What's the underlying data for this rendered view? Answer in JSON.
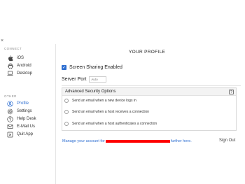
{
  "window": {
    "close_glyph": "×"
  },
  "sidebar": {
    "connect_label": "CONNECT",
    "connect_items": [
      {
        "label": "iOS",
        "icon": "apple-icon"
      },
      {
        "label": "Android",
        "icon": "android-icon"
      },
      {
        "label": "Desktop",
        "icon": "laptop-icon"
      }
    ],
    "other_label": "OTHER",
    "other_items": [
      {
        "label": "Profile",
        "icon": "user-icon",
        "active": true
      },
      {
        "label": "Settings",
        "icon": "gear-icon"
      },
      {
        "label": "Help Desk",
        "icon": "question-icon"
      },
      {
        "label": "E-Mail Us",
        "icon": "mail-icon"
      },
      {
        "label": "Quit App",
        "icon": "power-icon"
      }
    ]
  },
  "main": {
    "title": "YOUR PROFILE",
    "screen_sharing": {
      "label": "Screen Sharing Enabled",
      "checked": true
    },
    "server_port": {
      "label": "Server Port",
      "placeholder": "Auto"
    },
    "advanced": {
      "title": "Advanced Security Options",
      "help_glyph": "?",
      "options": [
        "Send an email when a new device logs in",
        "Send an email when a host receives a connection",
        "Send an email when a host authenticates a connection"
      ]
    },
    "footer": {
      "link_prefix": "Manage your account for",
      "link_suffix": "further here.",
      "signout": "Sign Out"
    }
  },
  "colors": {
    "accent": "#2f6fd1",
    "redaction": "#ff0000"
  }
}
